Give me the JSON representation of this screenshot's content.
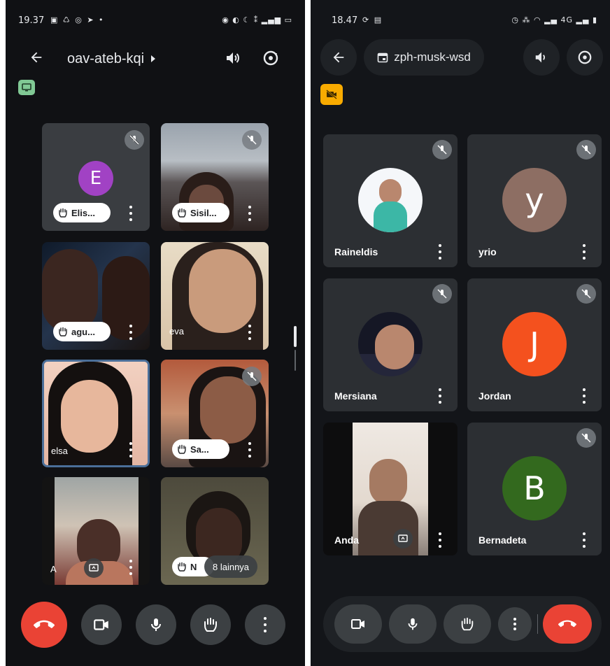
{
  "left": {
    "status": {
      "time": "19.37"
    },
    "header": {
      "meeting_code": "oav-ateb-kqi"
    },
    "tiles": [
      {
        "name": "Elis...",
        "avatar_letter": "E",
        "avatar_color": "#a142c4"
      },
      {
        "name": "Sisil..."
      },
      {
        "name": "agu..."
      },
      {
        "name": "eva"
      },
      {
        "name": "elsa"
      },
      {
        "name": "Sa..."
      },
      {
        "name": "A"
      },
      {
        "name": "N",
        "more": "8 lainnya"
      }
    ],
    "colors": {
      "end_call": "#ea4335",
      "control_bg": "#3c4043",
      "chip_bg": "#ffffff"
    }
  },
  "right": {
    "status": {
      "time": "18.47"
    },
    "header": {
      "meeting_code": "zph-musk-wsd"
    },
    "tiles": [
      {
        "name": "Raineldis"
      },
      {
        "name": "yrio",
        "avatar_letter": "y",
        "avatar_color": "#8d6e63"
      },
      {
        "name": "Mersiana"
      },
      {
        "name": "Jordan",
        "avatar_letter": "J",
        "avatar_color": "#f4511e"
      },
      {
        "name": "Anda"
      },
      {
        "name": "Bernadeta",
        "avatar_letter": "B",
        "avatar_color": "#33691e"
      }
    ],
    "colors": {
      "end_call": "#ea4335",
      "badge": "#f9ab00"
    }
  }
}
